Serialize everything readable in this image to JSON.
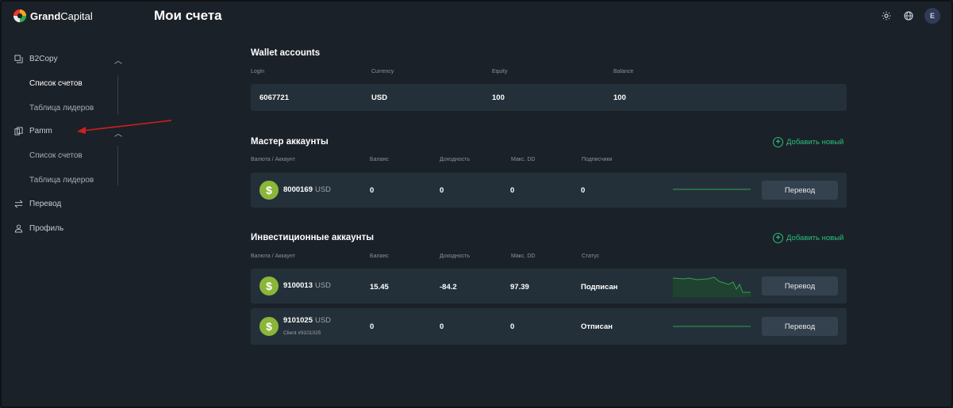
{
  "brand": {
    "name_bold": "Grand",
    "name_light": "Capital"
  },
  "page_title": "Мои счета",
  "header": {
    "user_initial": "E",
    "icons": [
      "sun-icon",
      "globe-icon"
    ]
  },
  "sidebar": {
    "groups": [
      {
        "label": "B2Copy",
        "icon": "copy-icon",
        "items": [
          "Список счетов",
          "Таблица лидеров"
        ],
        "active_item": "Список счетов"
      },
      {
        "label": "Pamm",
        "icon": "pamm-icon",
        "items": [
          "Список счетов",
          "Таблица лидеров"
        ]
      }
    ],
    "transfer": "Перевод",
    "profile": "Профиль"
  },
  "wallet": {
    "title": "Wallet accounts",
    "columns": [
      "Login",
      "Currency",
      "Equity",
      "Balance"
    ],
    "row": {
      "login": "6067721",
      "currency": "USD",
      "equity": "100",
      "balance": "100"
    }
  },
  "master": {
    "title": "Мастер аккаунты",
    "add_label": "Добавить новый",
    "columns": [
      "Валюта / Аккаунт",
      "Баланс",
      "Доходность",
      "Макс. DD",
      "Подписчики"
    ],
    "rows": [
      {
        "account": "8000169",
        "currency": "USD",
        "balance": "0",
        "yield": "0",
        "max_dd": "0",
        "subscribers": "0",
        "button": "Перевод"
      }
    ]
  },
  "investment": {
    "title": "Инвестиционные аккаунты",
    "add_label": "Добавить новый",
    "columns": [
      "Валюта / Аккаунт",
      "Баланс",
      "Доходность",
      "Макс. DD",
      "Статус"
    ],
    "rows": [
      {
        "account": "9100013",
        "currency": "USD",
        "balance": "15.45",
        "yield": "-84.2",
        "max_dd": "97.39",
        "status": "Подписан",
        "button": "Перевод"
      },
      {
        "account": "9101025",
        "currency": "USD",
        "client": "Client #9101025",
        "balance": "0",
        "yield": "0",
        "max_dd": "0",
        "status": "Отписан",
        "button": "Перевод"
      }
    ]
  },
  "colors": {
    "accent": "#27c07a",
    "coin": "#8bb63a",
    "row_bg": "#243039",
    "page_bg": "#1b2128",
    "annotation_arrow": "#d21e1e"
  }
}
